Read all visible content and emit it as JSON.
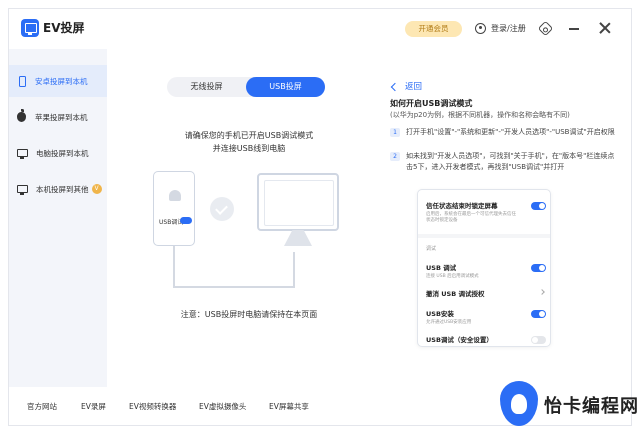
{
  "app": {
    "title": "EV投屏"
  },
  "titlebar": {
    "vip_label": "开通会员",
    "login_label": "登录/注册"
  },
  "sidebar": {
    "items": [
      {
        "label": "安卓投屏到本机",
        "icon": "phone-icon",
        "active": true
      },
      {
        "label": "苹果投屏到本机",
        "icon": "apple-icon",
        "active": false
      },
      {
        "label": "电脑投屏到本机",
        "icon": "monitor-icon",
        "active": false
      },
      {
        "label": "本机投屏到其他",
        "icon": "monitor-icon",
        "active": false,
        "badge": "V"
      }
    ]
  },
  "main": {
    "tabs": [
      {
        "label": "无线投屏",
        "active": false
      },
      {
        "label": "USB投屏",
        "active": true
      }
    ],
    "instruction_line1": "请确保您的手机已开启USB调试模式",
    "instruction_line2": "并连接USB线到电脑",
    "illustration_usb_label": "USB调试",
    "note": "注意：USB投屏时电脑请保持在本页面"
  },
  "help": {
    "back_label": "返回",
    "title": "如何开启USB调试模式",
    "subtitle": "(以华为p20为例，根据不同机器，操作和名称会略有不同)",
    "steps": [
      {
        "num": "1",
        "text": "打开手机\"设置\"-\"系统和更新\"-\"开发人员选项\"-\"USB调试\"开启权限"
      },
      {
        "num": "2",
        "text": "如未找到\"开发人员选项\"，可找到\"关于手机\"，在\"版本号\"栏连续点击5下，进入开发者模式，再找到\"USB调试\"并打开"
      }
    ],
    "phone_screenshot": {
      "row1_title": "信任状态结束时锁定屏幕",
      "row1_desc": "启用后，系统会在最后一个可信代理失去信任状态时锁定设备",
      "section_label": "调试",
      "row2_title": "USB 调试",
      "row2_desc": "连接 USB 后启用调试模式",
      "row3_title": "撤消 USB 调试授权",
      "row4_title": "USB安装",
      "row4_desc": "允许通过USB安装应用",
      "row5_title": "USB调试（安全设置）"
    }
  },
  "footer": {
    "links": [
      "官方网站",
      "EV录屏",
      "EV视频转换器",
      "EV虚拟摄像头",
      "EV屏幕共享"
    ]
  },
  "watermark": {
    "text": "怡卡编程网"
  },
  "colors": {
    "accent": "#2b6df5",
    "vip_bg": "#fde7b3",
    "sidebar_bg": "#f3f5fa"
  }
}
